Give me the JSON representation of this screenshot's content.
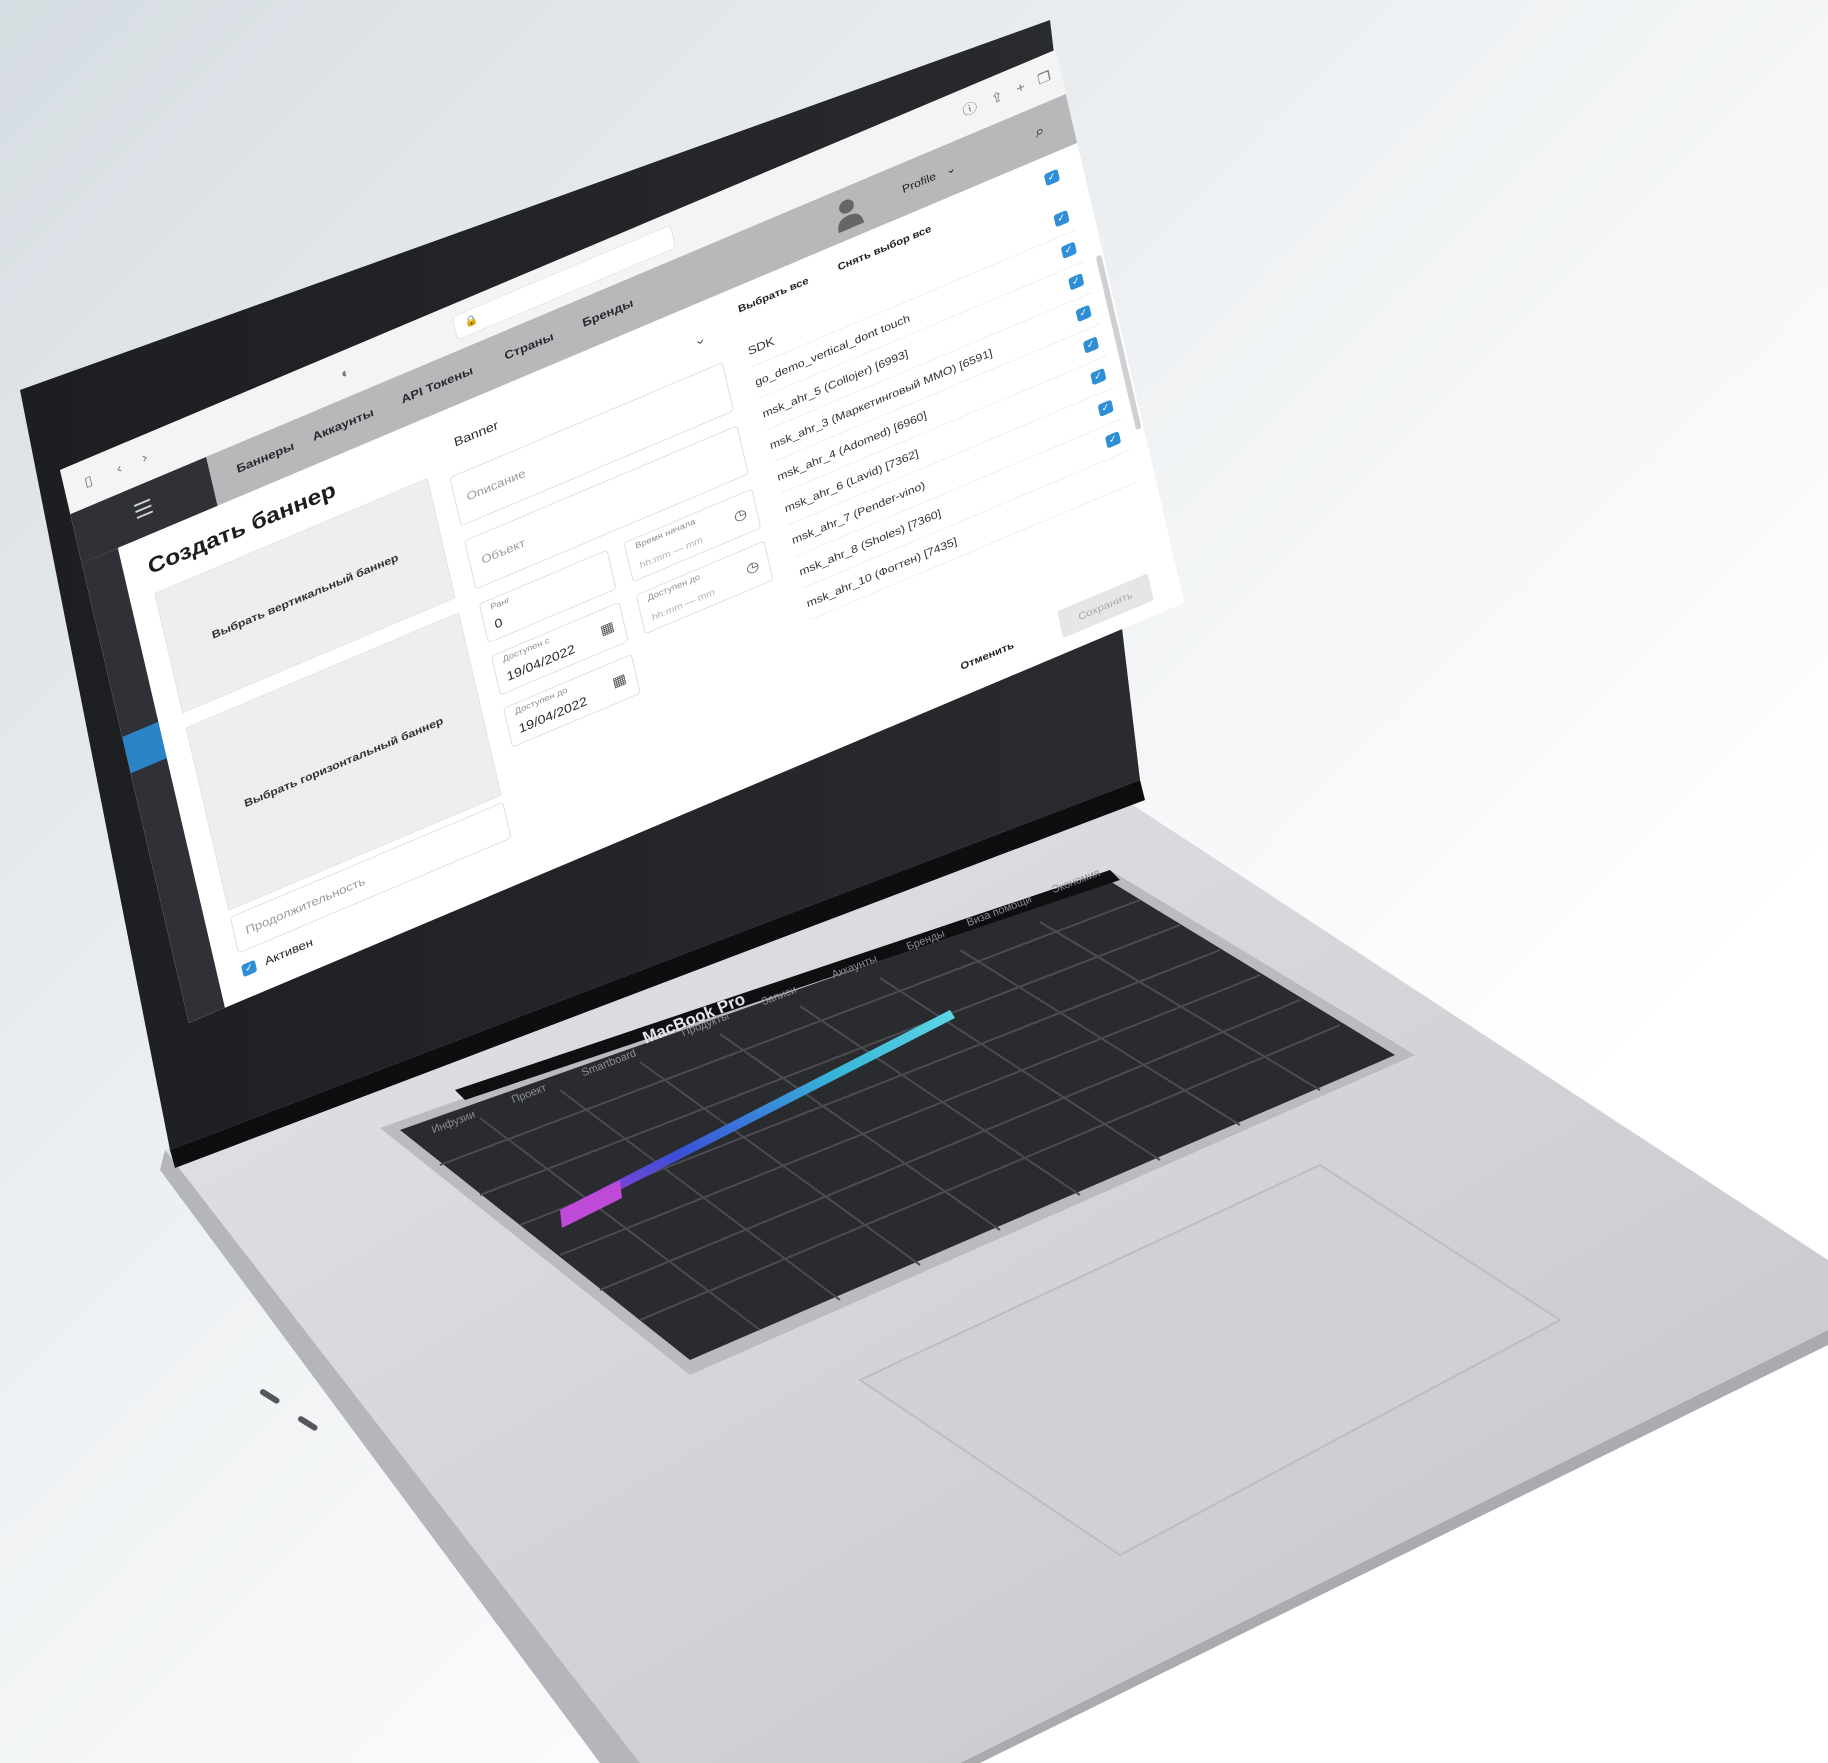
{
  "page": {
    "title": "Создать баннер"
  },
  "navbar": {
    "items": [
      "Баннеры",
      "Аккаунты",
      "API Токены",
      "Страны",
      "Бренды"
    ],
    "user": "Profile",
    "menu_icon": "menu-icon",
    "search_icon": "search-icon"
  },
  "browser": {
    "theme_toggle": "◐"
  },
  "form": {
    "vertical_banner": "Выбрать вертикальный баннер",
    "horizontal_banner": "Выбрать горизонтальный баннер",
    "type_value": "Banner",
    "description_placeholder": "Описание",
    "object_placeholder": "Объект",
    "rank_label": "Ранг",
    "rank_value": "0",
    "date_from_label": "Доступен с",
    "date_from_value": "19/04/2022",
    "time_start_label": "Время начала",
    "time_placeholder": "hh:mm — mm",
    "date_to_label": "Доступен до",
    "date_to_value": "19/04/2022",
    "time_end_label": "Доступен до",
    "duration_placeholder": "Продолжительность",
    "active_label": "Активен"
  },
  "sdk": {
    "select_all": "Выбрать все",
    "deselect_all": "Снять выбор все",
    "header": "SDK",
    "items": [
      "go_demo_vertical_dont touch",
      "msk_ahr_5 (Collojer) [6993]",
      "msk_ahr_3 (Маркетинговый MMO) [6591]",
      "msk_ahr_4 (Adomed) [6960]",
      "msk_ahr_6 (Lavid) [7362]",
      "msk_ahr_7 (Pender-vino)",
      "msk_ahr_8 (Sholes) [7360]",
      "msk_ahr_10 (Фогтен) [7435]"
    ],
    "cancel": "Отменить",
    "save": "Сохранить"
  },
  "device": {
    "brand": "MacBook Pro",
    "bottom_labels": [
      "Инфузии",
      "Проект",
      "Smartboard",
      "Продукты",
      "Записи",
      "Аккаунты",
      "Бренды",
      "Виза помощи",
      "Экономия"
    ]
  },
  "colors": {
    "accent": "#2f8fd6",
    "navbar": "#b8b8bb",
    "sidebar": "#2f3136",
    "laptop_body": "#c9cbcf"
  }
}
